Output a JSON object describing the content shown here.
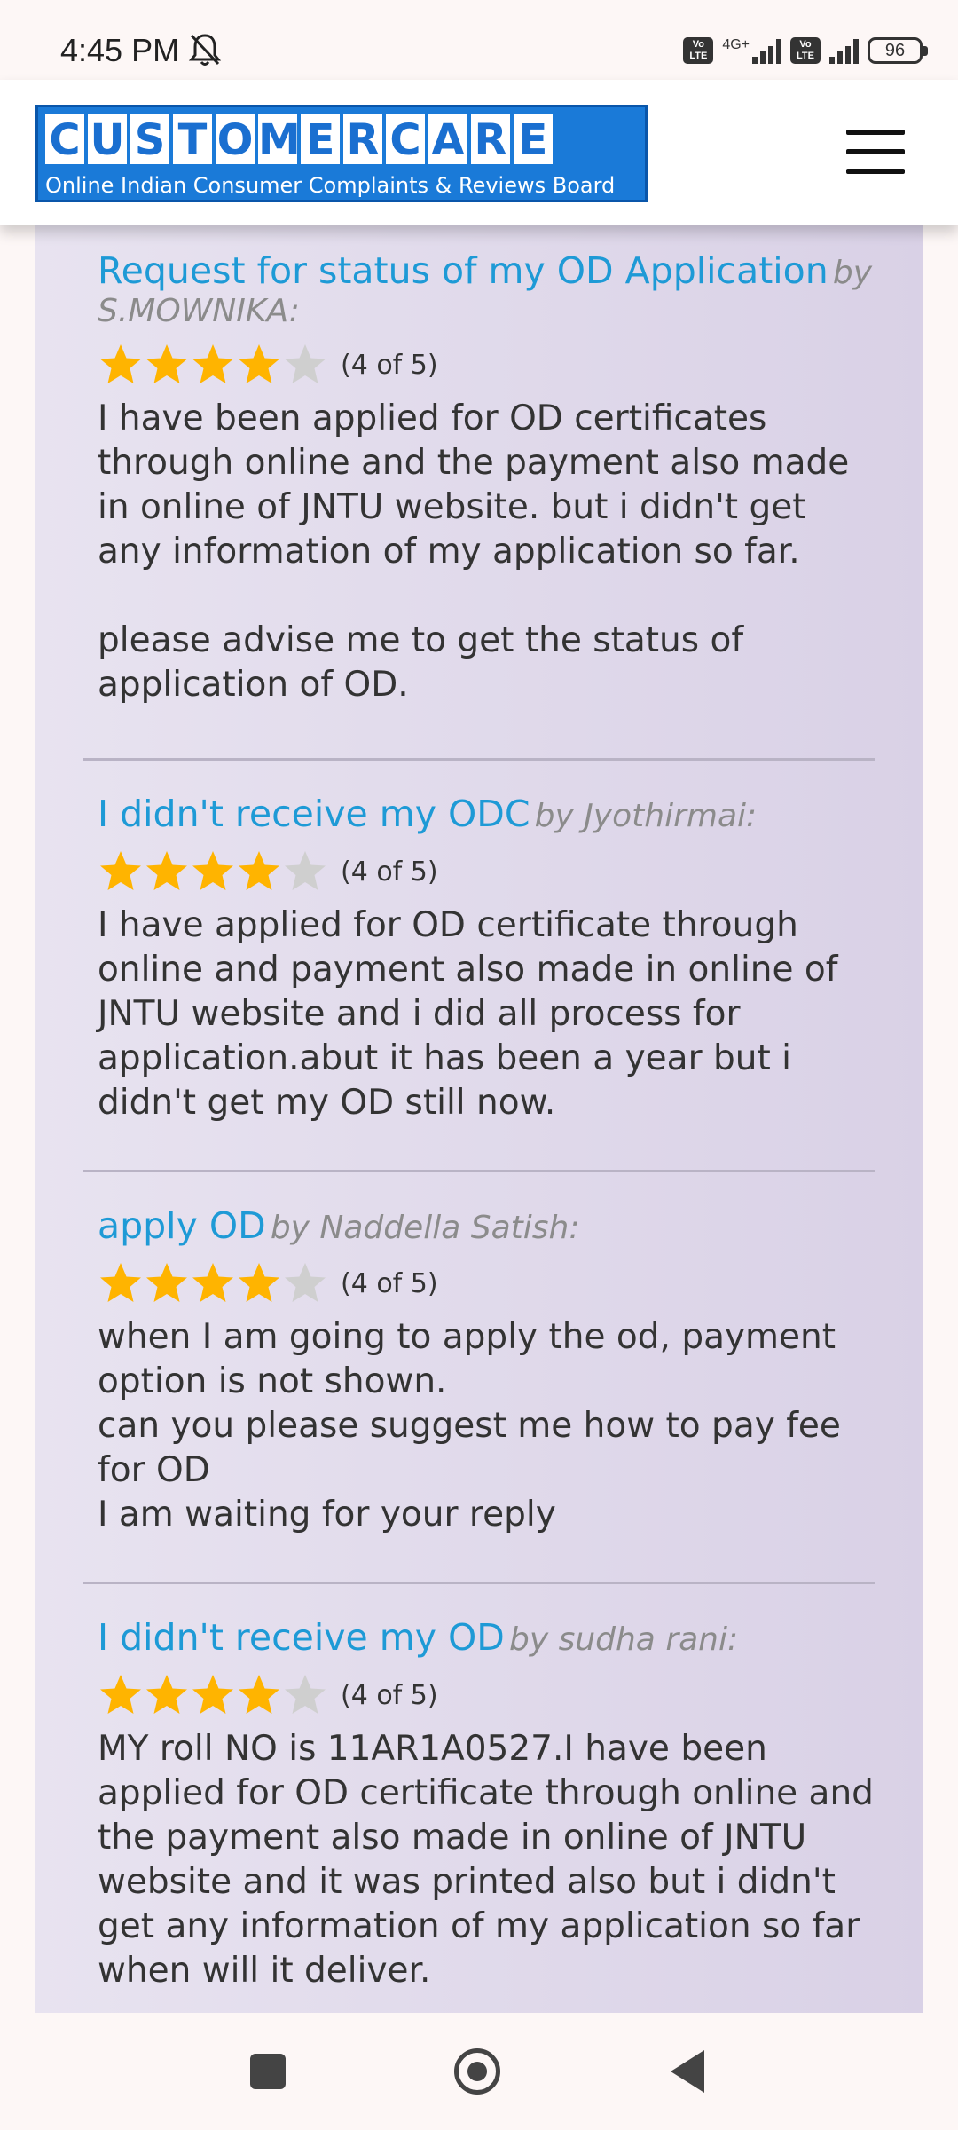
{
  "status_bar": {
    "time": "4:45 PM",
    "network_type": "4G+",
    "volte_label": "Vo LTE",
    "battery": "96"
  },
  "header": {
    "logo_letters": [
      "C",
      "U",
      "S",
      "T",
      "O",
      "M",
      "E",
      "R",
      "C",
      "A",
      "R",
      "E"
    ],
    "logo_subtitle": "Online Indian Consumer Complaints & Reviews Board",
    "menu_icon": "hamburger-icon"
  },
  "colors": {
    "link": "#1e9ad6",
    "star_filled": "#ffb400",
    "star_empty": "#cfcfcf",
    "logo_blue": "#1a7ad8"
  },
  "reviews": [
    {
      "title": "Request for status of my OD Application",
      "author": "by S.MOWNIKA:",
      "rating": 4,
      "rating_text": "(4 of 5)",
      "body": "I have been applied for OD certificates through online and the payment also made in online of JNTU website. but i didn't get any information of my application so far.\n\nplease advise me to get the status of application of OD."
    },
    {
      "title": "I didn't receive my ODC",
      "author": "by Jyothirmai:",
      "rating": 4,
      "rating_text": "(4 of 5)",
      "body": "I have applied for OD certificate through online and payment also made in online of JNTU website and i did all process for application.abut it has been a year but i didn't get my OD still now."
    },
    {
      "title": "apply OD",
      "author": "by Naddella Satish:",
      "rating": 4,
      "rating_text": "(4 of 5)",
      "body": "when I am going to apply the od, payment option is not shown.\ncan you please suggest me how to pay fee for OD\nI am waiting for your reply"
    },
    {
      "title": "I didn't receive my OD",
      "author": "by sudha rani:",
      "rating": 4,
      "rating_text": "(4 of 5)",
      "body": "MY roll NO is 11AR1A0527.I have been applied for OD certificate through online and the payment also made in online of JNTU website and it was printed also but i didn't get any information of my application so far when will it deliver."
    }
  ],
  "nav_bar": {
    "recents_icon": "square-icon",
    "home_icon": "circle-icon",
    "back_icon": "triangle-back-icon"
  }
}
